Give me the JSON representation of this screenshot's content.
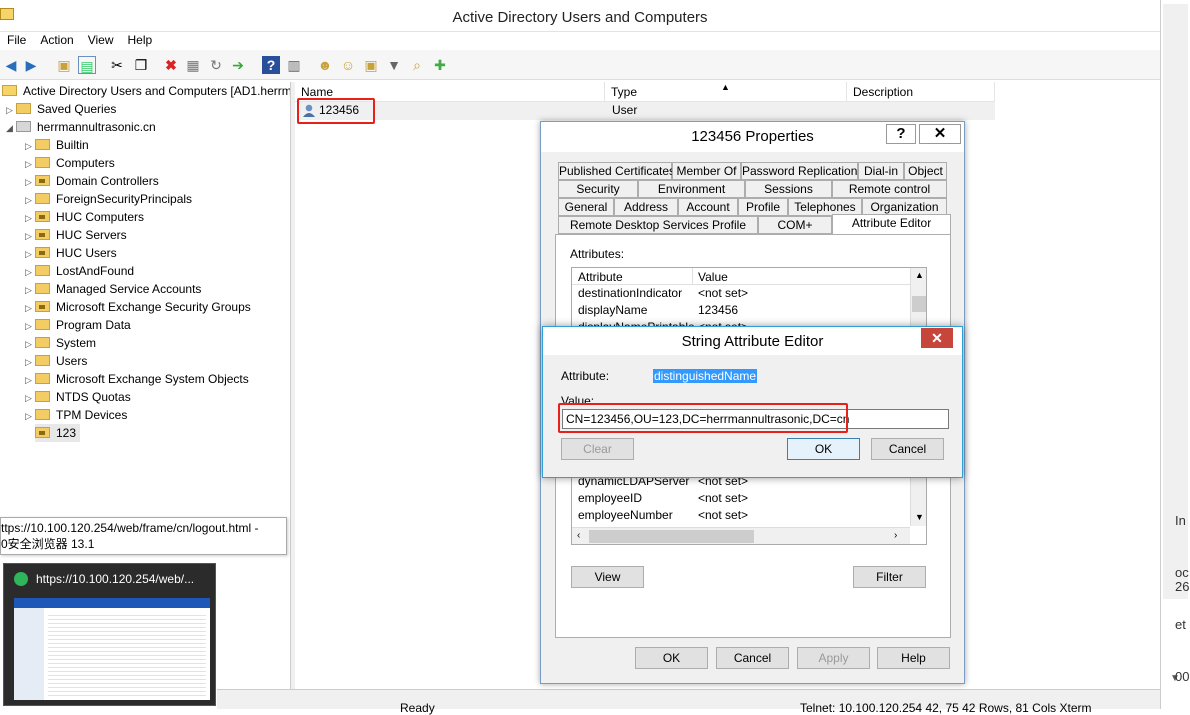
{
  "window": {
    "title": "Active Directory Users and Computers"
  },
  "menu": [
    "File",
    "Action",
    "View",
    "Help"
  ],
  "tree": {
    "root": "Active Directory Users and Computers [AD1.herrma",
    "saved_queries": "Saved Queries",
    "domain": "herrmannultrasonic.cn",
    "children": [
      "Builtin",
      "Computers",
      "Domain Controllers",
      "ForeignSecurityPrincipals",
      "HUC Computers",
      "HUC Servers",
      "HUC Users",
      "LostAndFound",
      "Managed Service Accounts",
      "Microsoft Exchange Security Groups",
      "Program Data",
      "System",
      "Users",
      "Microsoft Exchange System Objects",
      "NTDS Quotas",
      "TPM Devices",
      "123"
    ]
  },
  "list": {
    "columns": [
      "Name",
      "Type",
      "Description"
    ],
    "rows": [
      {
        "name": "123456",
        "type": "User",
        "description": ""
      }
    ]
  },
  "tooltip": {
    "line1": "ttps://10.100.120.254/web/frame/cn/logout.html -",
    "line2": "0安全浏览器 13.1"
  },
  "thumbnail": {
    "title": "https://10.100.120.254/web/..."
  },
  "statusbar": {
    "left": "Ready",
    "right": "Telnet: 10.100.120.254   42, 75   42 Rows, 81 Cols   Xterm"
  },
  "properties": {
    "title": "123456 Properties",
    "help_label": "?",
    "close_label": "✕",
    "tabs_row1": [
      "Published Certificates",
      "Member Of",
      "Password Replication",
      "Dial-in",
      "Object"
    ],
    "tabs_row2": [
      "Security",
      "Environment",
      "Sessions",
      "Remote control"
    ],
    "tabs_row3": [
      "General",
      "Address",
      "Account",
      "Profile",
      "Telephones",
      "Organization"
    ],
    "tabs_row4": [
      "Remote Desktop Services Profile",
      "COM+",
      "Attribute Editor"
    ],
    "attributes_label": "Attributes:",
    "attr_columns": [
      "Attribute",
      "Value"
    ],
    "attr_rows_top": [
      {
        "name": "destinationIndicator",
        "value": "<not set>"
      },
      {
        "name": "displayName",
        "value": "123456"
      },
      {
        "name": "displayNamePrintable",
        "value": "<not set>"
      }
    ],
    "attr_rows_bottom": [
      {
        "name": "dynamicLDAPServer",
        "value": "<not set>"
      },
      {
        "name": "employeeID",
        "value": "<not set>"
      },
      {
        "name": "employeeNumber",
        "value": "<not set>"
      }
    ],
    "view_button": "View",
    "filter_button": "Filter",
    "ok_button": "OK",
    "cancel_button": "Cancel",
    "apply_button": "Apply",
    "help_button": "Help"
  },
  "string_editor": {
    "title": "String Attribute Editor",
    "close_label": "✕",
    "attribute_label": "Attribute:",
    "attribute_value": "distinguishedName",
    "value_label": "Value:",
    "value": "CN=123456,OU=123,DC=herrmannultrasonic,DC=cn",
    "clear_button": "Clear",
    "ok_button": "OK",
    "cancel_button": "Cancel"
  },
  "edge_fragments": [
    "In",
    "oc",
    "26",
    "et",
    "00"
  ],
  "colors": {
    "highlight_red": "#e8201a",
    "selection_blue": "#3399ff",
    "dialog_border": "#2f9fd8"
  }
}
